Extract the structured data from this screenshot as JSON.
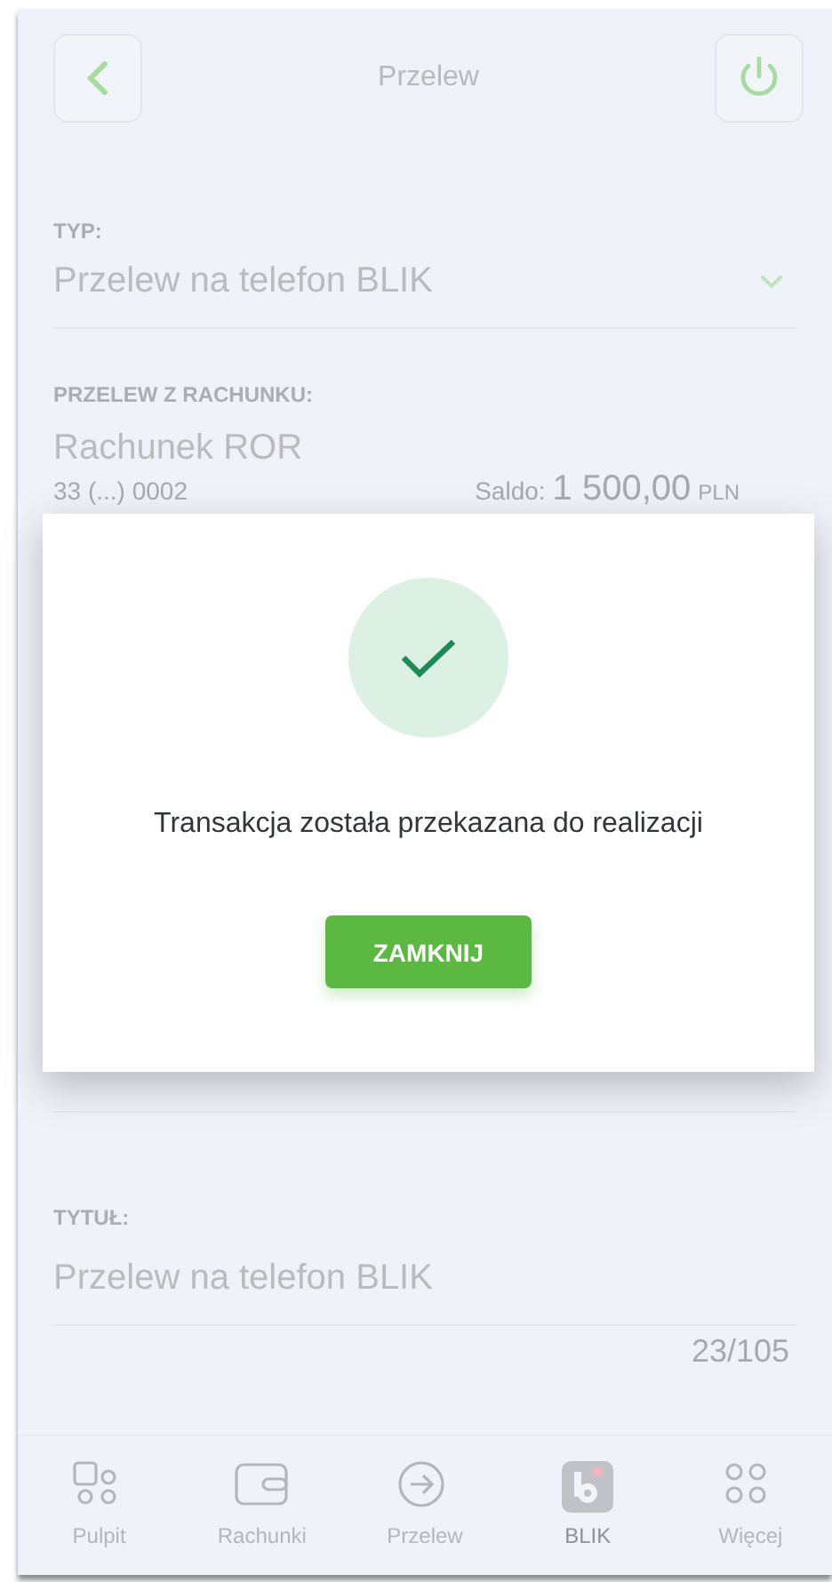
{
  "header": {
    "title": "Przelew"
  },
  "form": {
    "type": {
      "label": "TYP:",
      "value": "Przelew na telefon BLIK"
    },
    "account": {
      "label": "PRZELEW Z RACHUNKU:",
      "name": "Rachunek ROR",
      "number": "33 (...) 0002",
      "balance_label": "Saldo:",
      "balance_amount": "1 500,00",
      "balance_currency": "PLN"
    },
    "title": {
      "label": "TYTUŁ:",
      "value": "Przelew na telefon BLIK",
      "counter": "23/105"
    }
  },
  "nav": [
    {
      "kind": "dashboard",
      "label": "Pulpit",
      "selected": false
    },
    {
      "kind": "wallet",
      "label": "Rachunki",
      "selected": false
    },
    {
      "kind": "transfer",
      "label": "Przelew",
      "selected": false
    },
    {
      "kind": "blik",
      "label": "BLIK",
      "selected": true
    },
    {
      "kind": "more",
      "label": "Więcej",
      "selected": false
    }
  ],
  "dialog": {
    "message": "Transakcja została przekazana do realizacji",
    "button": "ZAMKNIJ"
  }
}
